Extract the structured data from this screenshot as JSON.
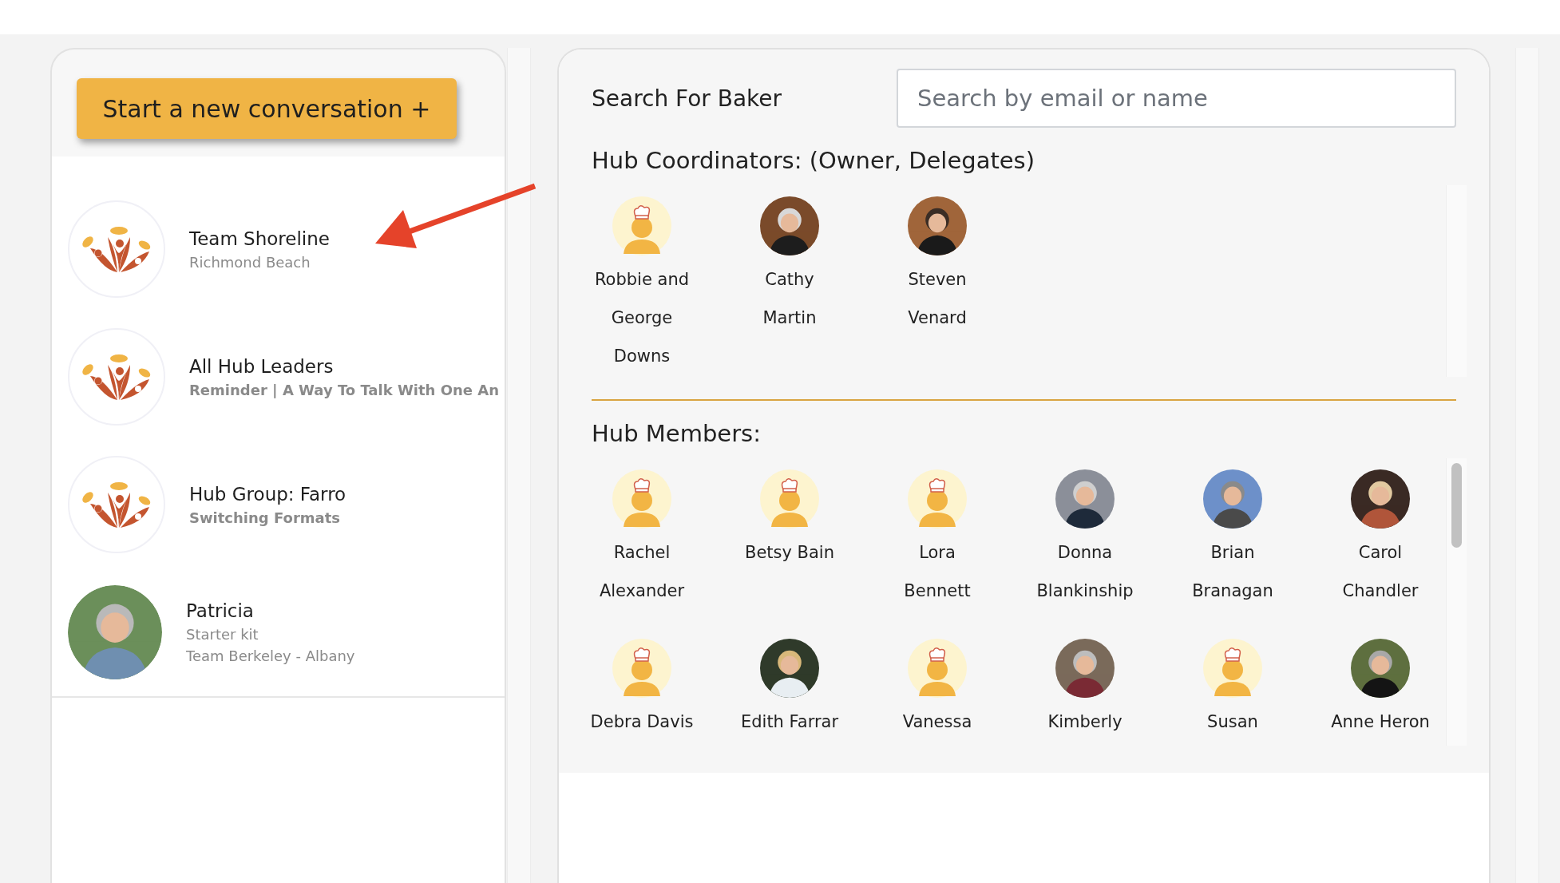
{
  "new_conversation_button": "Start a new conversation +",
  "conversations": [
    {
      "title": "Team Shoreline",
      "kind": "logo",
      "preview_bold": false,
      "lines": [
        "Richmond Beach"
      ]
    },
    {
      "title": "All Hub Leaders",
      "kind": "logo",
      "preview_bold": true,
      "lines": [
        "Reminder | A Way To Talk With One An"
      ]
    },
    {
      "title": "Hub Group: Farro",
      "kind": "logo",
      "preview_bold": true,
      "lines": [
        "Switching Formats"
      ]
    },
    {
      "title": "Patricia",
      "preview_bold": false,
      "lines": [
        "Starter kit",
        "Team Berkeley - Albany"
      ]
    }
  ],
  "search": {
    "label": "Search For Baker",
    "placeholder": "Search by email or name"
  },
  "coordinators": {
    "heading": "Hub Coordinators: (Owner, Delegates)",
    "people": [
      {
        "name": "Robbie and\nGeorge\nDowns",
        "kind": "default"
      },
      {
        "name": "Cathy\nMartin"
      },
      {
        "name": "Steven\nVenard"
      }
    ]
  },
  "members": {
    "heading": "Hub Members:",
    "people": [
      {
        "name": "Rachel\nAlexander",
        "kind": "default"
      },
      {
        "name": "Betsy Bain",
        "kind": "default"
      },
      {
        "name": "Lora\nBennett",
        "kind": "default"
      },
      {
        "name": "Donna\nBlankinship"
      },
      {
        "name": "Brian\nBranagan"
      },
      {
        "name": "Carol\nChandler"
      },
      {
        "name": "Debra Davis",
        "kind": "default"
      },
      {
        "name": "Edith Farrar"
      },
      {
        "name": "Vanessa",
        "kind": "default"
      },
      {
        "name": "Kimberly"
      },
      {
        "name": "Susan",
        "kind": "default"
      },
      {
        "name": "Anne Heron"
      }
    ]
  }
}
